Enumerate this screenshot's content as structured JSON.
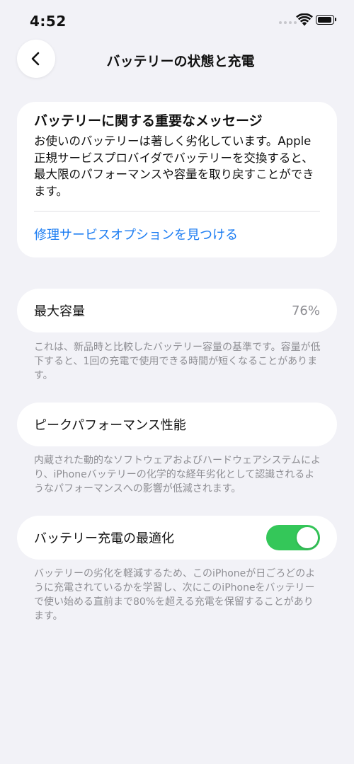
{
  "status_bar": {
    "time": "4:52",
    "icons": [
      "cellular-dots-icon",
      "wifi-icon",
      "battery-icon"
    ]
  },
  "nav": {
    "back_icon": "chevron-left-icon",
    "title": "バッテリーの状態と充電"
  },
  "message_card": {
    "title": "バッテリーに関する重要なメッセージ",
    "body": "お使いのバッテリーは著しく劣化しています。Apple正規サービスプロバイダでバッテリーを交換すると、最大限のパフォーマンスや容量を取り戻すことができます。",
    "link": "修理サービスオプションを見つける"
  },
  "max_capacity": {
    "label": "最大容量",
    "value": "76%",
    "note": "これは、新品時と比較したバッテリー容量の基準です。容量が低下すると、1回の充電で使用できる時間が短くなることがあります。"
  },
  "peak_performance": {
    "label": "ピークパフォーマンス性能",
    "note": "内蔵された動的なソフトウェアおよびハードウェアシステムにより、iPhoneバッテリーの化学的な経年劣化として認識されるようなパフォーマンスへの影響が低減されます。"
  },
  "optimized_charging": {
    "label": "バッテリー充電の最適化",
    "enabled": true,
    "note": "バッテリーの劣化を軽減するため、このiPhoneが日ごろどのように充電されているかを学習し、次にこのiPhoneをバッテリーで使い始める直前まで80%を超える充電を保留することがあります。"
  },
  "colors": {
    "background": "#f2f2f7",
    "card": "#ffffff",
    "link": "#1b7cf2",
    "toggle_on": "#34c759",
    "secondary_text": "#8e8e93"
  }
}
